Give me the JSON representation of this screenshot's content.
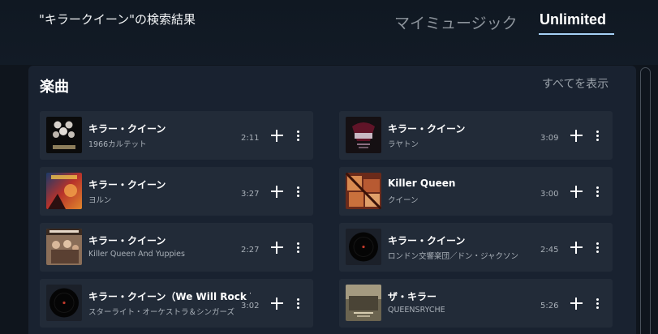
{
  "header": {
    "search_title": "\"キラークイーン\"の検索結果",
    "tabs": [
      {
        "label": "マイミュージック",
        "active": false
      },
      {
        "label": "Unlimited",
        "active": true
      }
    ]
  },
  "section": {
    "title": "楽曲",
    "see_all_label": "すべてを表示"
  },
  "tracks": [
    {
      "title": "キラー・クイーン",
      "artist": "1966カルテット",
      "duration": "2:11",
      "art_icon": "queen-ii-album-art-icon"
    },
    {
      "title": "キラー・クイーン",
      "artist": "ラヤトン",
      "duration": "3:09",
      "art_icon": "queen-crest-album-art-icon"
    },
    {
      "title": "キラー・クイーン",
      "artist": "ヨルン",
      "duration": "3:27",
      "art_icon": "fantasy-album-art-icon"
    },
    {
      "title": "Killer Queen",
      "artist": "クイーン",
      "duration": "3:00",
      "art_icon": "sheer-heart-attack-album-art-icon"
    },
    {
      "title": "キラー・クイーン",
      "artist": "Killer Queen And Yuppies",
      "duration": "2:27",
      "art_icon": "yuppies-album-art-icon"
    },
    {
      "title": "キラー・クイーン",
      "artist": "ロンドン交響楽団／ドン・ジャクソン",
      "duration": "2:45",
      "art_icon": "vinyl-record-icon"
    },
    {
      "title": "キラー・クイーン（We Will Rock You）",
      "artist": "スターライト・オーケストラ＆シンガーズ",
      "duration": "3:02",
      "art_icon": "vinyl-record-icon"
    },
    {
      "title": "ザ・キラー",
      "artist": "QUEENSRYCHE",
      "duration": "5:26",
      "art_icon": "queensryche-album-art-icon"
    }
  ],
  "controls": {
    "add_icon": "plus-icon",
    "more_icon": "more-vertical-icon"
  },
  "colors": {
    "background": "#0f151d",
    "panel": "#192230",
    "track_card": "#222b38",
    "tab_underline": "#a5d0f5",
    "secondary_text": "#a9b0b8"
  }
}
